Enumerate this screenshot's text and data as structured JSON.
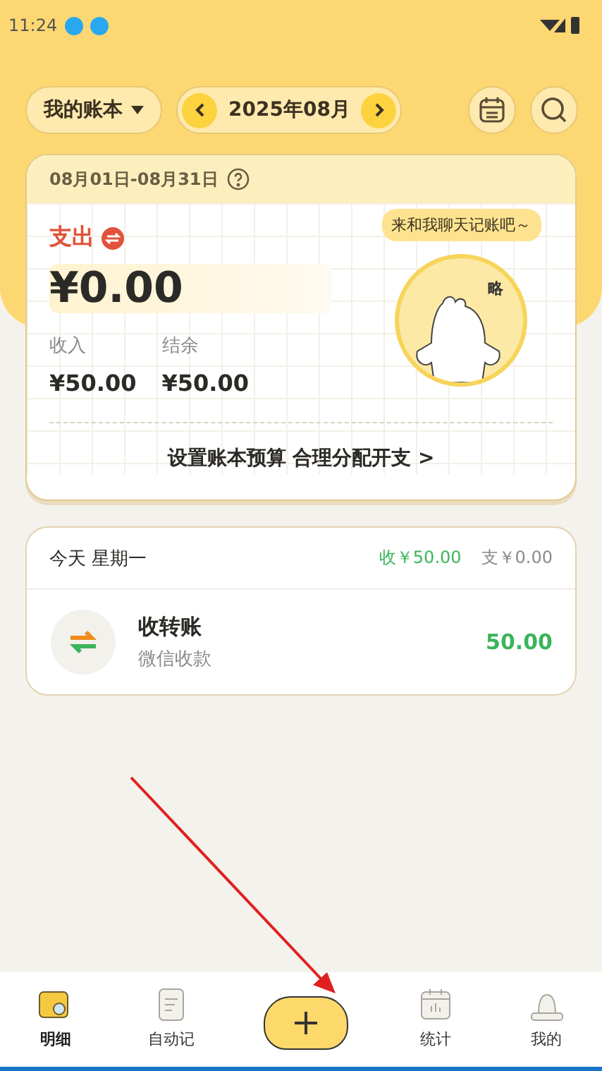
{
  "status_bar": {
    "time": "11:24"
  },
  "header": {
    "account": "我的账本",
    "month": "2025年08月"
  },
  "summary": {
    "date_range": "08月01日-08月31日",
    "type_label": "支出",
    "amount": "¥0.00",
    "stats": [
      {
        "label": "收入",
        "value": "¥50.00"
      },
      {
        "label": "结余",
        "value": "¥50.00"
      }
    ],
    "bubble": "来和我聊天记账吧～",
    "mascot_text": "略",
    "budget_link": "设置账本预算 合理分配开支 >"
  },
  "day": {
    "title": "今天 星期一",
    "income": "收￥50.00",
    "expense": "支￥0.00",
    "records": [
      {
        "title": "收转账",
        "note": "微信收款",
        "amount": "50.00"
      }
    ]
  },
  "tab_bar": {
    "items": [
      {
        "label": "明细",
        "kind": "detail",
        "selected": true
      },
      {
        "label": "自动记",
        "kind": "auto",
        "selected": false
      },
      {
        "label": "统计",
        "kind": "stats",
        "selected": false
      },
      {
        "label": "我的",
        "kind": "mine",
        "selected": false
      }
    ]
  }
}
